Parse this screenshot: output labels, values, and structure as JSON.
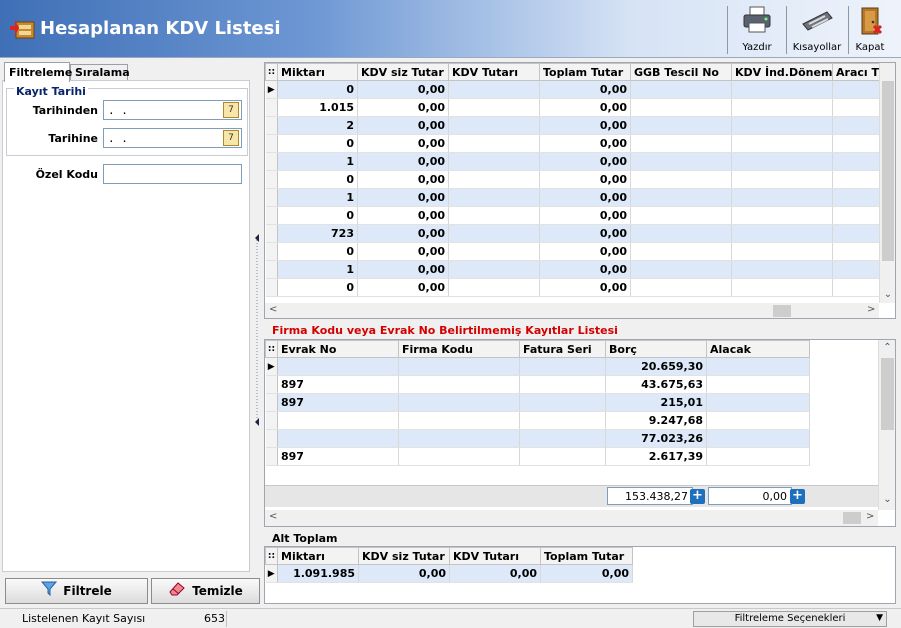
{
  "window": {
    "title": "Hesaplanan KDV Listesi"
  },
  "toolbar": {
    "print_label": "Yazdır",
    "shortcuts_label": "Kısayollar",
    "close_label": "Kapat"
  },
  "tabs": [
    {
      "label": "Filtreleme"
    },
    {
      "label": "Sıralama"
    }
  ],
  "filters": {
    "group_title": "Kayıt Tarihi",
    "from_label": "Tarihinden",
    "from_value": " .  .",
    "to_label": "Tarihine",
    "to_value": " .  .",
    "special_code_label": "Özel Kodu",
    "special_code_value": "",
    "calendar_glyph": "7"
  },
  "buttons": {
    "filter_label": "Filtrele",
    "clear_label": "Temizle"
  },
  "main_grid": {
    "columns": [
      "Miktarı",
      "KDV siz Tutar",
      "KDV Tutarı",
      "Toplam Tutar",
      "GGB Tescil No",
      "KDV İnd.Dönemi",
      "Aracı TC"
    ],
    "rows": [
      [
        "0",
        "0,00",
        "",
        "0,00",
        "",
        "",
        ""
      ],
      [
        "1.015",
        "0,00",
        "",
        "0,00",
        "",
        "",
        ""
      ],
      [
        "2",
        "0,00",
        "",
        "0,00",
        "",
        "",
        ""
      ],
      [
        "0",
        "0,00",
        "",
        "0,00",
        "",
        "",
        ""
      ],
      [
        "1",
        "0,00",
        "",
        "0,00",
        "",
        "",
        ""
      ],
      [
        "0",
        "0,00",
        "",
        "0,00",
        "",
        "",
        ""
      ],
      [
        "1",
        "0,00",
        "",
        "0,00",
        "",
        "",
        ""
      ],
      [
        "0",
        "0,00",
        "",
        "0,00",
        "",
        "",
        ""
      ],
      [
        "723",
        "0,00",
        "",
        "0,00",
        "",
        "",
        ""
      ],
      [
        "0",
        "0,00",
        "",
        "0,00",
        "",
        "",
        ""
      ],
      [
        "1",
        "0,00",
        "",
        "0,00",
        "",
        "",
        ""
      ],
      [
        "0",
        "0,00",
        "",
        "0,00",
        "",
        "",
        ""
      ]
    ]
  },
  "unmatched": {
    "caption": "Firma Kodu veya Evrak No Belirtilmemiş Kayıtlar Listesi",
    "columns": [
      "Evrak No",
      "Firma Kodu",
      "Fatura Seri",
      "Borç",
      "Alacak"
    ],
    "rows": [
      [
        "",
        "",
        "",
        "20.659,30",
        ""
      ],
      [
        "897",
        "",
        "",
        "43.675,63",
        ""
      ],
      [
        "897",
        "",
        "",
        "215,01",
        ""
      ],
      [
        "",
        "",
        "",
        "9.247,68",
        ""
      ],
      [
        "",
        "",
        "",
        "77.023,26",
        ""
      ],
      [
        "897",
        "",
        "",
        "2.617,39",
        ""
      ]
    ],
    "total_debit": "153.438,27",
    "total_credit": "0,00",
    "plus_glyph": "+"
  },
  "subtotal": {
    "caption": "Alt Toplam",
    "columns": [
      "Miktarı",
      "KDV siz Tutar",
      "KDV Tutarı",
      "Toplam Tutar"
    ],
    "row": [
      "1.091.985",
      "0,00",
      "0,00",
      "0,00"
    ]
  },
  "status": {
    "record_count_label": "Listelenen Kayıt Sayısı",
    "record_count": "653",
    "filter_options_label": "Filtreleme Seçenekleri"
  },
  "glyphs": {
    "row_pointer": "▶",
    "grid_corner": "::",
    "arrow_up": "⌃",
    "arrow_down": "⌄",
    "arrow_left": "<",
    "arrow_right": ">",
    "dropdown": "▼"
  },
  "colors": {
    "header_start": "#3f6fb6",
    "alt_row": "#dde9f8",
    "caption_red": "#d40000"
  }
}
